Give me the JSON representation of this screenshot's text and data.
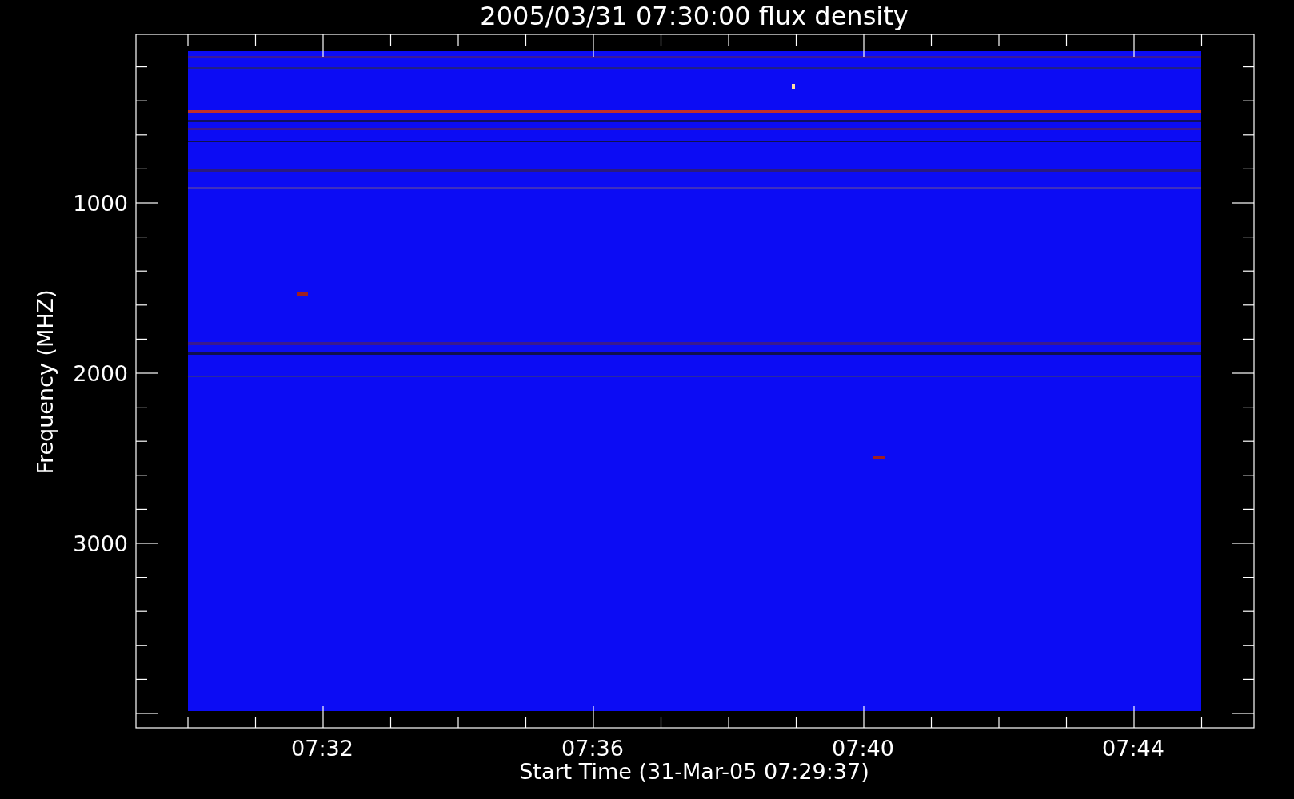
{
  "title": "2005/03/31 07:30:00 flux density",
  "y_axis": {
    "label": "Frequency (MHZ)",
    "ticks": [
      "1000",
      "2000",
      "3000"
    ]
  },
  "x_axis": {
    "label": "Start Time (31-Mar-05 07:29:37)",
    "ticks": [
      "07:32",
      "07:36",
      "07:40",
      "07:44"
    ]
  }
}
